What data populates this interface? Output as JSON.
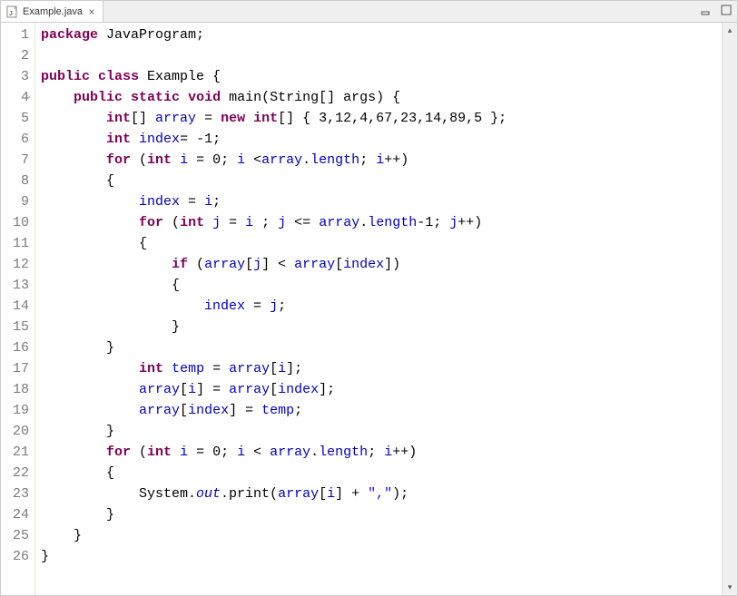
{
  "tab": {
    "filename": "Example.java",
    "close_glyph": "×"
  },
  "gutter": {
    "lines": [
      "1",
      "2",
      "3",
      "4",
      "5",
      "6",
      "7",
      "8",
      "9",
      "10",
      "11",
      "12",
      "13",
      "14",
      "15",
      "16",
      "17",
      "18",
      "19",
      "20",
      "21",
      "22",
      "23",
      "24",
      "25",
      "26"
    ],
    "override_marker_line": 4,
    "override_marker_glyph": "▷"
  },
  "code": {
    "tokens": [
      [
        {
          "t": "package",
          "c": "kw"
        },
        {
          "t": " JavaProgram;",
          "c": ""
        }
      ],
      [
        {
          "t": "",
          "c": ""
        }
      ],
      [
        {
          "t": "public",
          "c": "kw"
        },
        {
          "t": " ",
          "c": ""
        },
        {
          "t": "class",
          "c": "kw"
        },
        {
          "t": " Example {",
          "c": ""
        }
      ],
      [
        {
          "t": "    ",
          "c": ""
        },
        {
          "t": "public",
          "c": "kw"
        },
        {
          "t": " ",
          "c": ""
        },
        {
          "t": "static",
          "c": "kw"
        },
        {
          "t": " ",
          "c": ""
        },
        {
          "t": "void",
          "c": "kw"
        },
        {
          "t": " main(String[] args) {",
          "c": ""
        }
      ],
      [
        {
          "t": "        ",
          "c": ""
        },
        {
          "t": "int",
          "c": "kw"
        },
        {
          "t": "[] ",
          "c": ""
        },
        {
          "t": "array",
          "c": "fld"
        },
        {
          "t": " = ",
          "c": ""
        },
        {
          "t": "new",
          "c": "kw"
        },
        {
          "t": " ",
          "c": ""
        },
        {
          "t": "int",
          "c": "kw"
        },
        {
          "t": "[] { 3,12,4,67,23,14,89,5 };",
          "c": ""
        }
      ],
      [
        {
          "t": "        ",
          "c": ""
        },
        {
          "t": "int",
          "c": "kw"
        },
        {
          "t": " ",
          "c": ""
        },
        {
          "t": "index",
          "c": "fld"
        },
        {
          "t": "= -1;",
          "c": ""
        }
      ],
      [
        {
          "t": "        ",
          "c": ""
        },
        {
          "t": "for",
          "c": "kw"
        },
        {
          "t": " (",
          "c": ""
        },
        {
          "t": "int",
          "c": "kw"
        },
        {
          "t": " ",
          "c": ""
        },
        {
          "t": "i",
          "c": "fld"
        },
        {
          "t": " = 0; ",
          "c": ""
        },
        {
          "t": "i",
          "c": "fld"
        },
        {
          "t": " <",
          "c": ""
        },
        {
          "t": "array",
          "c": "fld"
        },
        {
          "t": ".",
          "c": ""
        },
        {
          "t": "length",
          "c": "fld"
        },
        {
          "t": "; ",
          "c": ""
        },
        {
          "t": "i",
          "c": "fld"
        },
        {
          "t": "++)",
          "c": ""
        }
      ],
      [
        {
          "t": "        {",
          "c": ""
        }
      ],
      [
        {
          "t": "            ",
          "c": ""
        },
        {
          "t": "index",
          "c": "fld"
        },
        {
          "t": " = ",
          "c": ""
        },
        {
          "t": "i",
          "c": "fld"
        },
        {
          "t": ";",
          "c": ""
        }
      ],
      [
        {
          "t": "            ",
          "c": ""
        },
        {
          "t": "for",
          "c": "kw"
        },
        {
          "t": " (",
          "c": ""
        },
        {
          "t": "int",
          "c": "kw"
        },
        {
          "t": " ",
          "c": ""
        },
        {
          "t": "j",
          "c": "fld"
        },
        {
          "t": " = ",
          "c": ""
        },
        {
          "t": "i",
          "c": "fld"
        },
        {
          "t": " ; ",
          "c": ""
        },
        {
          "t": "j",
          "c": "fld"
        },
        {
          "t": " <= ",
          "c": ""
        },
        {
          "t": "array",
          "c": "fld"
        },
        {
          "t": ".",
          "c": ""
        },
        {
          "t": "length",
          "c": "fld"
        },
        {
          "t": "-1; ",
          "c": ""
        },
        {
          "t": "j",
          "c": "fld"
        },
        {
          "t": "++)",
          "c": ""
        }
      ],
      [
        {
          "t": "            {",
          "c": ""
        }
      ],
      [
        {
          "t": "                ",
          "c": ""
        },
        {
          "t": "if",
          "c": "kw"
        },
        {
          "t": " (",
          "c": ""
        },
        {
          "t": "array",
          "c": "fld"
        },
        {
          "t": "[",
          "c": ""
        },
        {
          "t": "j",
          "c": "fld"
        },
        {
          "t": "] < ",
          "c": ""
        },
        {
          "t": "array",
          "c": "fld"
        },
        {
          "t": "[",
          "c": ""
        },
        {
          "t": "index",
          "c": "fld"
        },
        {
          "t": "])",
          "c": ""
        }
      ],
      [
        {
          "t": "                {",
          "c": ""
        }
      ],
      [
        {
          "t": "                    ",
          "c": ""
        },
        {
          "t": "index",
          "c": "fld"
        },
        {
          "t": " = ",
          "c": ""
        },
        {
          "t": "j",
          "c": "fld"
        },
        {
          "t": ";",
          "c": ""
        }
      ],
      [
        {
          "t": "                }",
          "c": ""
        }
      ],
      [
        {
          "t": "        }",
          "c": ""
        }
      ],
      [
        {
          "t": "            ",
          "c": ""
        },
        {
          "t": "int",
          "c": "kw"
        },
        {
          "t": " ",
          "c": ""
        },
        {
          "t": "temp",
          "c": "fld"
        },
        {
          "t": " = ",
          "c": ""
        },
        {
          "t": "array",
          "c": "fld"
        },
        {
          "t": "[",
          "c": ""
        },
        {
          "t": "i",
          "c": "fld"
        },
        {
          "t": "];",
          "c": ""
        }
      ],
      [
        {
          "t": "            ",
          "c": ""
        },
        {
          "t": "array",
          "c": "fld"
        },
        {
          "t": "[",
          "c": ""
        },
        {
          "t": "i",
          "c": "fld"
        },
        {
          "t": "] = ",
          "c": ""
        },
        {
          "t": "array",
          "c": "fld"
        },
        {
          "t": "[",
          "c": ""
        },
        {
          "t": "index",
          "c": "fld"
        },
        {
          "t": "];",
          "c": ""
        }
      ],
      [
        {
          "t": "            ",
          "c": ""
        },
        {
          "t": "array",
          "c": "fld"
        },
        {
          "t": "[",
          "c": ""
        },
        {
          "t": "index",
          "c": "fld"
        },
        {
          "t": "] = ",
          "c": ""
        },
        {
          "t": "temp",
          "c": "fld"
        },
        {
          "t": ";",
          "c": ""
        }
      ],
      [
        {
          "t": "        }",
          "c": ""
        }
      ],
      [
        {
          "t": "        ",
          "c": ""
        },
        {
          "t": "for",
          "c": "kw"
        },
        {
          "t": " (",
          "c": ""
        },
        {
          "t": "int",
          "c": "kw"
        },
        {
          "t": " ",
          "c": ""
        },
        {
          "t": "i",
          "c": "fld"
        },
        {
          "t": " = 0; ",
          "c": ""
        },
        {
          "t": "i",
          "c": "fld"
        },
        {
          "t": " < ",
          "c": ""
        },
        {
          "t": "array",
          "c": "fld"
        },
        {
          "t": ".",
          "c": ""
        },
        {
          "t": "length",
          "c": "fld"
        },
        {
          "t": "; ",
          "c": ""
        },
        {
          "t": "i",
          "c": "fld"
        },
        {
          "t": "++)",
          "c": ""
        }
      ],
      [
        {
          "t": "        {",
          "c": ""
        }
      ],
      [
        {
          "t": "            System.",
          "c": ""
        },
        {
          "t": "out",
          "c": "fldi"
        },
        {
          "t": ".print(",
          "c": ""
        },
        {
          "t": "array",
          "c": "fld"
        },
        {
          "t": "[",
          "c": ""
        },
        {
          "t": "i",
          "c": "fld"
        },
        {
          "t": "] + ",
          "c": ""
        },
        {
          "t": "\",\"",
          "c": "str"
        },
        {
          "t": ");",
          "c": ""
        }
      ],
      [
        {
          "t": "        }",
          "c": ""
        }
      ],
      [
        {
          "t": "    }",
          "c": ""
        }
      ],
      [
        {
          "t": "}",
          "c": ""
        }
      ]
    ]
  }
}
